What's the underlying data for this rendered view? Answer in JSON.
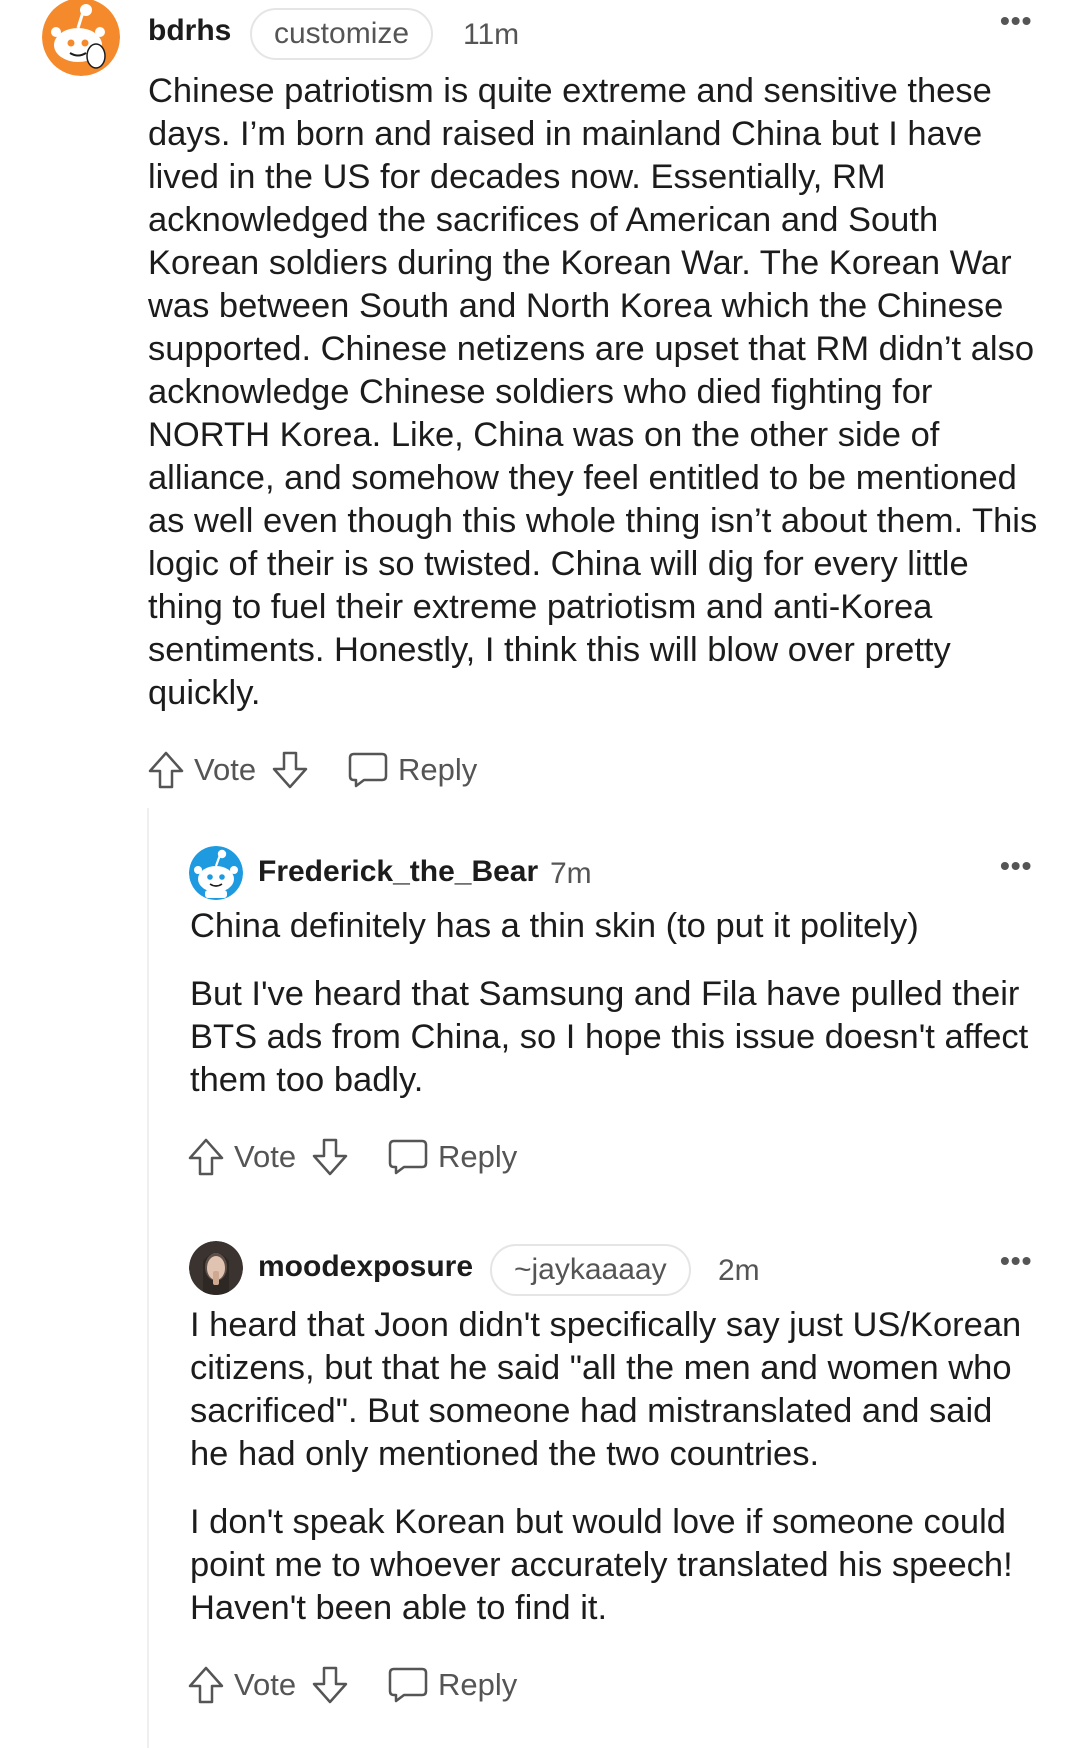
{
  "comments": [
    {
      "username": "bdrhs",
      "flair": "customize",
      "time": "11m",
      "paragraphs": [
        "Chinese patriotism is quite extreme and sensitive these days. I’m born and raised in mainland China but I have lived in the US for decades now. Essentially, RM acknowledged the sacrifices of American and South Korean soldiers during the Korean War. The Korean War was between South and North Korea which the Chinese supported. Chinese netizens are upset that RM didn’t also acknowledge Chinese soldiers who died fighting for NORTH Korea. Like, China was on the other side of alliance, and somehow they feel entitled to be mentioned as well even though this whole thing isn’t about them. This logic of their is so twisted. China will dig for every little thing to fuel their extreme patriotism and anti-Korea sentiments. Honestly, I think this will blow over pretty quickly."
      ],
      "vote_label": "Vote",
      "reply_label": "Reply"
    },
    {
      "username": "Frederick_the_Bear",
      "time": "7m",
      "paragraphs": [
        "China definitely has a thin skin (to put it politely)",
        "But I've heard that Samsung and Fila have pulled their BTS ads from China, so I hope this issue doesn't affect them too badly."
      ],
      "vote_label": "Vote",
      "reply_label": "Reply"
    },
    {
      "username": "moodexposure",
      "flair": "~jaykaaaay",
      "time": "2m",
      "paragraphs": [
        "I heard that Joon didn't specifically say just US/Korean citizens, but that he said \"all the men and women who sacrificed\". But someone had mistranslated and said he had only mentioned the two countries.",
        "I don't speak Korean but would love if someone could point me to whoever accurately translated his speech! Haven't been able to find it."
      ],
      "vote_label": "Vote",
      "reply_label": "Reply"
    }
  ],
  "more_label": "•••",
  "icons": {
    "upvote": "upvote-arrow-icon",
    "downvote": "downvote-arrow-icon",
    "reply": "speech-bubble-icon",
    "more": "more-options-icon"
  },
  "colors": {
    "text": "#1c1c1c",
    "muted": "#555555",
    "snoo_orange": "#f58a2c",
    "snoo_blue": "#1e9be0",
    "thread_line": "#edeff1"
  }
}
